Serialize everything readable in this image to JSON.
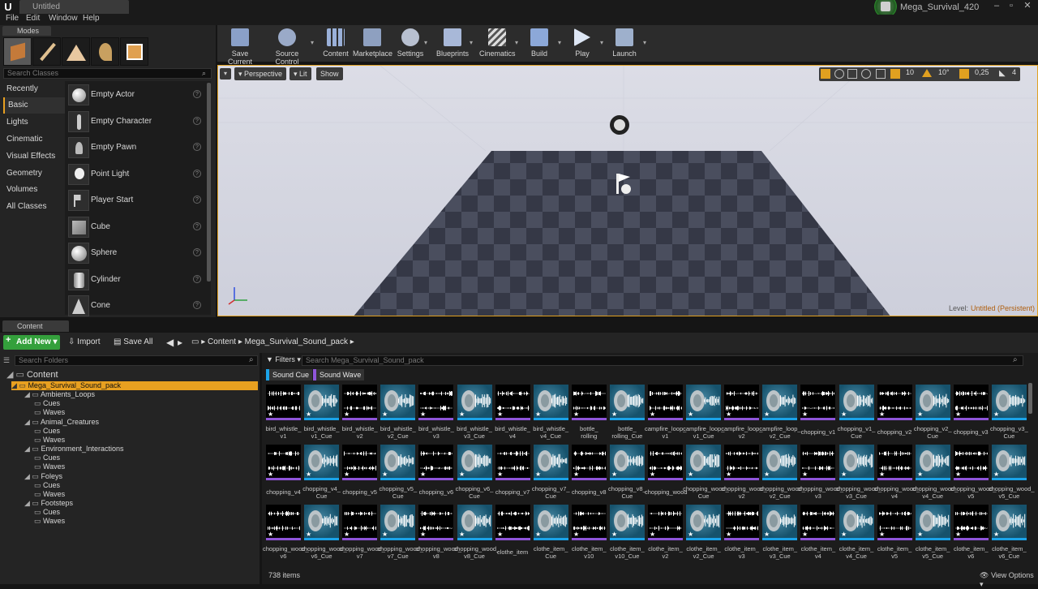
{
  "window": {
    "doc_tab": "Untitled",
    "project": "Mega_Survival_420"
  },
  "menu": [
    "File",
    "Edit",
    "Window",
    "Help"
  ],
  "modes": {
    "tab": "Modes",
    "search_placeholder": "Search Classes",
    "categories": [
      "Recently Placed",
      "Basic",
      "Lights",
      "Cinematic",
      "Visual Effects",
      "Geometry",
      "Volumes",
      "All Classes"
    ],
    "active_category": "Basic",
    "items": [
      "Empty Actor",
      "Empty Character",
      "Empty Pawn",
      "Point Light",
      "Player Start",
      "Cube",
      "Sphere",
      "Cylinder",
      "Cone"
    ],
    "help_glyph": "?"
  },
  "toolbar": [
    "Save Current",
    "Source Control",
    "Content",
    "Marketplace",
    "Settings",
    "Blueprints",
    "Cinematics",
    "Build",
    "Play",
    "Launch"
  ],
  "viewport": {
    "perspective": "Perspective",
    "lit": "Lit",
    "show": "Show",
    "grid_snap": "10",
    "rot_snap": "10°",
    "scale_snap": "0,25",
    "cam_speed": "4",
    "level_label": "Level:",
    "level_value": "Untitled (Persistent)"
  },
  "content_browser": {
    "tab": "Content Browser",
    "add_new": "Add New",
    "import": "Import",
    "save_all": "Save All",
    "breadcrumb": [
      "Content",
      "Mega_Survival_Sound_pack"
    ],
    "search_folders_placeholder": "Search Folders",
    "filters": "Filters",
    "search_assets_placeholder": "Search Mega_Survival_Sound_pack",
    "chips": [
      {
        "label": "Sound Cue",
        "color": "#1ba3e8"
      },
      {
        "label": "Sound Wave",
        "color": "#8f55d9"
      }
    ],
    "tree": [
      {
        "label": "Content",
        "level": 0
      },
      {
        "label": "Mega_Survival_Sound_pack",
        "level": 1,
        "selected": true
      },
      {
        "label": "Ambients_Loops",
        "level": 2
      },
      {
        "label": "Cues",
        "level": 3
      },
      {
        "label": "Waves",
        "level": 3
      },
      {
        "label": "Animal_Creatures",
        "level": 2
      },
      {
        "label": "Cues",
        "level": 3
      },
      {
        "label": "Waves",
        "level": 3
      },
      {
        "label": "Environment_Interactions",
        "level": 2
      },
      {
        "label": "Cues",
        "level": 3
      },
      {
        "label": "Waves",
        "level": 3
      },
      {
        "label": "Foleys",
        "level": 2
      },
      {
        "label": "Cues",
        "level": 3
      },
      {
        "label": "Waves",
        "level": 3
      },
      {
        "label": "Footsteps",
        "level": 2
      },
      {
        "label": "Cues",
        "level": 3
      },
      {
        "label": "Waves",
        "level": 3
      }
    ],
    "assets": [
      [
        "bird_whistle_v1",
        "w"
      ],
      [
        "bird_whistle_v1_Cue",
        "c"
      ],
      [
        "bird_whistle_v2",
        "w"
      ],
      [
        "bird_whistle_v2_Cue",
        "c"
      ],
      [
        "bird_whistle_v3",
        "w"
      ],
      [
        "bird_whistle_v3_Cue",
        "c"
      ],
      [
        "bird_whistle_v4",
        "w"
      ],
      [
        "bird_whistle_v4_Cue",
        "c"
      ],
      [
        "bottle_rolling",
        "w"
      ],
      [
        "bottle_rolling_Cue",
        "c"
      ],
      [
        "campfire_loop_v1",
        "w"
      ],
      [
        "campfire_loop_v1_Cue",
        "c"
      ],
      [
        "campfire_loop_v2",
        "w"
      ],
      [
        "campfire_loop_v2_Cue",
        "c"
      ],
      [
        "chopping_v1",
        "w"
      ],
      [
        "chopping_v1_Cue",
        "c"
      ],
      [
        "chopping_v2",
        "w"
      ],
      [
        "chopping_v2_Cue",
        "c"
      ],
      [
        "chopping_v3",
        "w"
      ],
      [
        "chopping_v3_Cue",
        "c"
      ],
      [
        "chopping_v4",
        "w"
      ],
      [
        "chopping_v4_Cue",
        "c"
      ],
      [
        "chopping_v5",
        "w"
      ],
      [
        "chopping_v5_Cue",
        "c"
      ],
      [
        "chopping_v6",
        "w"
      ],
      [
        "chopping_v6_Cue",
        "c"
      ],
      [
        "chopping_v7",
        "w"
      ],
      [
        "chopping_v7_Cue",
        "c"
      ],
      [
        "chopping_v8",
        "w"
      ],
      [
        "chopping_v8_Cue",
        "c"
      ],
      [
        "chopping_wood",
        "w"
      ],
      [
        "chopping_wood_Cue",
        "c"
      ],
      [
        "chopping_wood_v2",
        "w"
      ],
      [
        "chopping_wood_v2_Cue",
        "c"
      ],
      [
        "chopping_wood_v3",
        "w"
      ],
      [
        "chopping_wood_v3_Cue",
        "c"
      ],
      [
        "chopping_wood_v4",
        "w"
      ],
      [
        "chopping_wood_v4_Cue",
        "c"
      ],
      [
        "chopping_wood_v5",
        "w"
      ],
      [
        "chopping_wood_v5_Cue",
        "c"
      ],
      [
        "chopping_wood_v6",
        "w"
      ],
      [
        "chopping_wood_v6_Cue",
        "c"
      ],
      [
        "chopping_wood_v7",
        "w"
      ],
      [
        "chopping_wood_v7_Cue",
        "c"
      ],
      [
        "chopping_wood_v8",
        "w"
      ],
      [
        "chopping_wood_v8_Cue",
        "c"
      ],
      [
        "clothe_item",
        "w"
      ],
      [
        "clothe_item_Cue",
        "c"
      ],
      [
        "clothe_item_v10",
        "w"
      ],
      [
        "clothe_item_v10_Cue",
        "c"
      ],
      [
        "clothe_item_v2",
        "w"
      ],
      [
        "clothe_item_v2_Cue",
        "c"
      ],
      [
        "clothe_item_v3",
        "w"
      ],
      [
        "clothe_item_v3_Cue",
        "c"
      ],
      [
        "clothe_item_v4",
        "w"
      ],
      [
        "clothe_item_v4_Cue",
        "c"
      ],
      [
        "clothe_item_v5",
        "w"
      ],
      [
        "clothe_item_v5_Cue",
        "c"
      ],
      [
        "clothe_item_v6",
        "w"
      ],
      [
        "clothe_item_v6_Cue",
        "c"
      ]
    ],
    "items_count": "738 items",
    "view_options": "View Options"
  }
}
